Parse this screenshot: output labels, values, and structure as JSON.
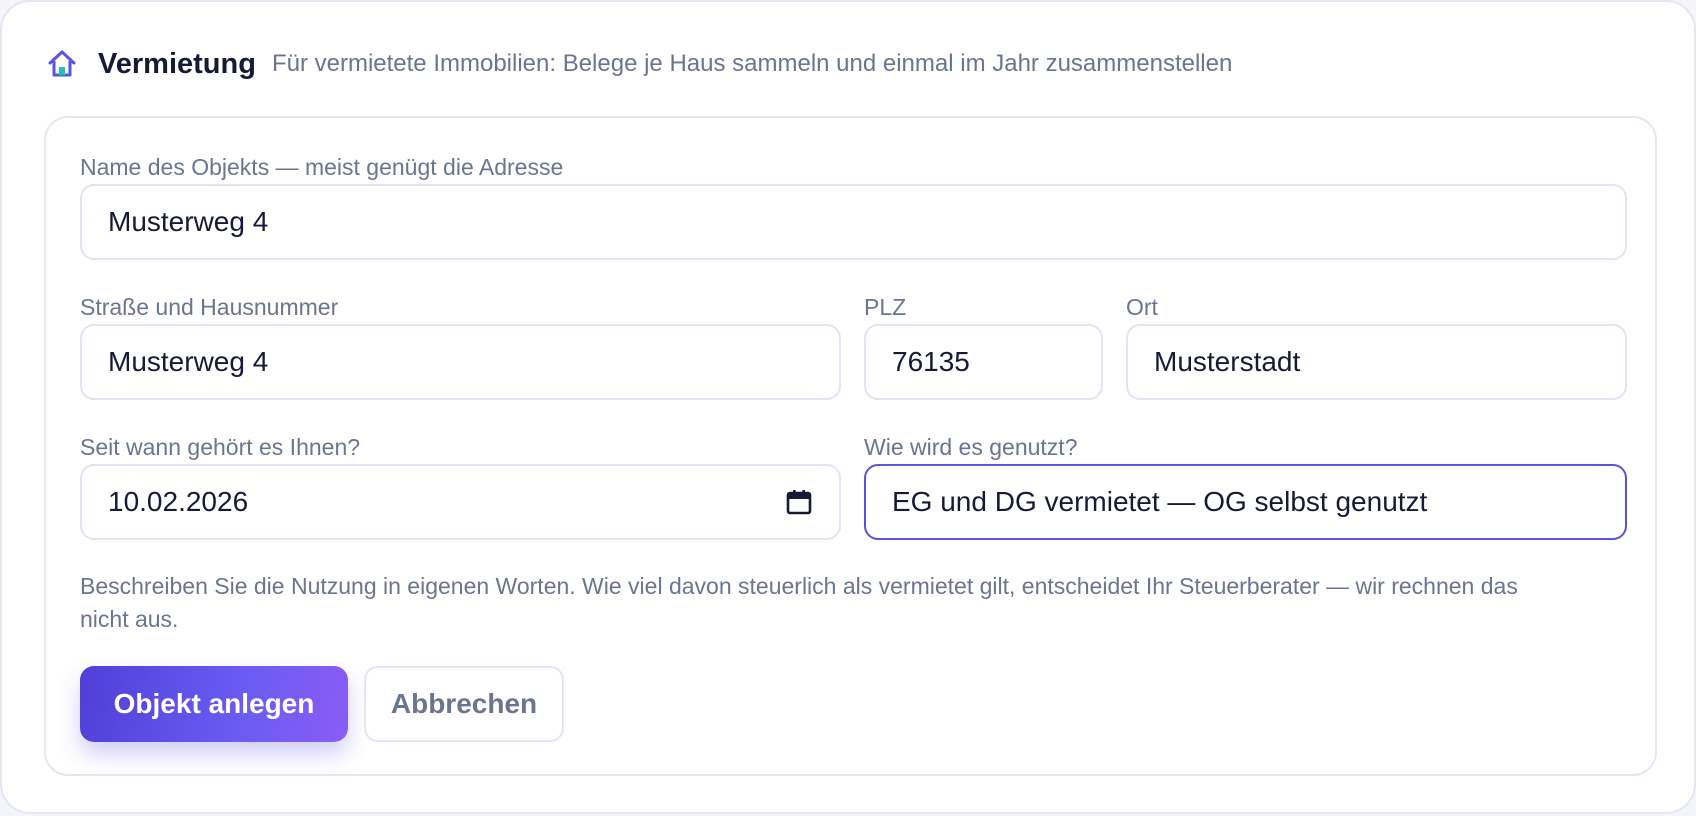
{
  "header": {
    "title": "Vermietung",
    "subtitle": "Für vermietete Immobilien: Belege je Haus sammeln und einmal im Jahr zusammenstellen",
    "icon": "home-icon"
  },
  "form": {
    "object_name": {
      "label": "Name des Objekts — meist genügt die Adresse",
      "value": "Musterweg 4"
    },
    "street": {
      "label": "Straße und Hausnummer",
      "value": "Musterweg 4"
    },
    "zip": {
      "label": "PLZ",
      "value": "76135"
    },
    "city": {
      "label": "Ort",
      "value": "Musterstadt"
    },
    "since": {
      "label": "Seit wann gehört es Ihnen?",
      "value": "10.02.2026",
      "icon": "calendar-icon"
    },
    "usage": {
      "label": "Wie wird es genutzt?",
      "value": "EG und DG vermietet — OG selbst genutzt",
      "focused": true
    },
    "hint": "Beschreiben Sie die Nutzung in eigenen Worten. Wie viel davon steuerlich als vermietet gilt, entscheidet Ihr Steuerberater — wir rechnen das nicht aus."
  },
  "actions": {
    "create_label": "Objekt anlegen",
    "cancel_label": "Abbrechen"
  },
  "colors": {
    "accent": "#5a52e0",
    "accent_gradient_end": "#8b5cf6",
    "icon_teal": "#22c3b0",
    "text_dark": "#161a35",
    "text_muted": "#6a7590",
    "border": "#e4e4f2"
  }
}
